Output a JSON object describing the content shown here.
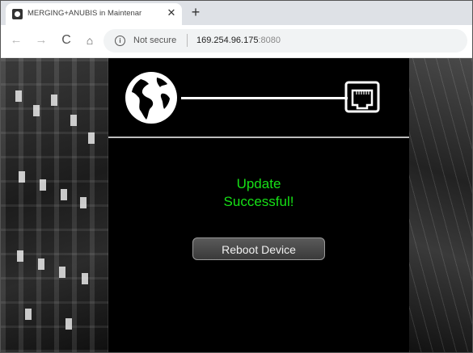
{
  "browser": {
    "tab": {
      "title": "MERGING+ANUBIS in Maintenar",
      "close_glyph": "✕"
    },
    "new_tab_glyph": "+",
    "nav": {
      "back": "←",
      "forward": "→",
      "reload": "C",
      "home": "⌂"
    },
    "address": {
      "security_text": "Not secure",
      "host": "169.254.96.175",
      "port": ":8080"
    }
  },
  "page": {
    "status_line1": "Update",
    "status_line2": "Successful!",
    "reboot_label": "Reboot Device",
    "colors": {
      "status": "#16e016",
      "panel": "#000000",
      "button": "#4a4a4a"
    },
    "icons": {
      "left": "globe-icon",
      "right": "ethernet-port-icon"
    }
  }
}
